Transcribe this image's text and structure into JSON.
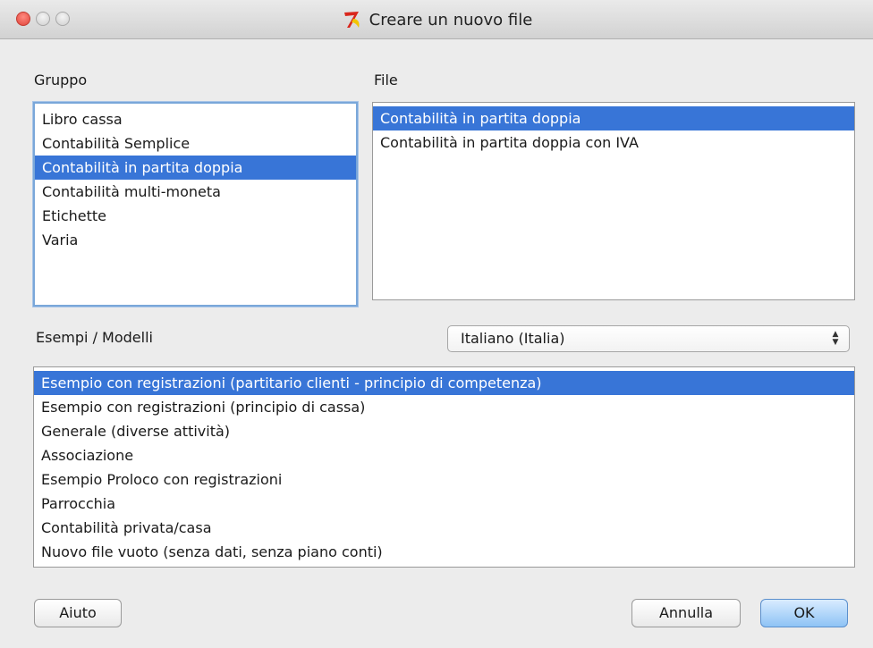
{
  "window": {
    "title": "Creare un nuovo file",
    "app_icon": "banana-app-icon"
  },
  "group": {
    "label": "Gruppo",
    "items": [
      {
        "label": "Libro cassa",
        "selected": false
      },
      {
        "label": "Contabilità Semplice",
        "selected": false
      },
      {
        "label": "Contabilità in partita doppia",
        "selected": true
      },
      {
        "label": "Contabilità multi-moneta",
        "selected": false
      },
      {
        "label": "Etichette",
        "selected": false
      },
      {
        "label": "Varia",
        "selected": false
      }
    ]
  },
  "file": {
    "label": "File",
    "items": [
      {
        "label": "Contabilità in partita doppia",
        "selected": true
      },
      {
        "label": "Contabilità in partita doppia con IVA",
        "selected": false
      }
    ]
  },
  "examples": {
    "label": "Esempi / Modelli",
    "language_select": "Italiano (Italia)",
    "items": [
      {
        "label": "Esempio con registrazioni (partitario clienti - principio di competenza)",
        "selected": true
      },
      {
        "label": "Esempio con registrazioni (principio di cassa)",
        "selected": false
      },
      {
        "label": "Generale (diverse attività)",
        "selected": false
      },
      {
        "label": "Associazione",
        "selected": false
      },
      {
        "label": "Esempio Proloco con registrazioni",
        "selected": false
      },
      {
        "label": "Parrocchia",
        "selected": false
      },
      {
        "label": "Contabilità privata/casa",
        "selected": false
      },
      {
        "label": "Nuovo file vuoto (senza dati, senza piano conti)",
        "selected": false
      }
    ]
  },
  "buttons": {
    "help": "Aiuto",
    "cancel": "Annulla",
    "ok": "OK"
  },
  "colors": {
    "selection": "#3875d7",
    "focus_ring": "#7aa7d9",
    "default_button": "#8ec3f5"
  }
}
